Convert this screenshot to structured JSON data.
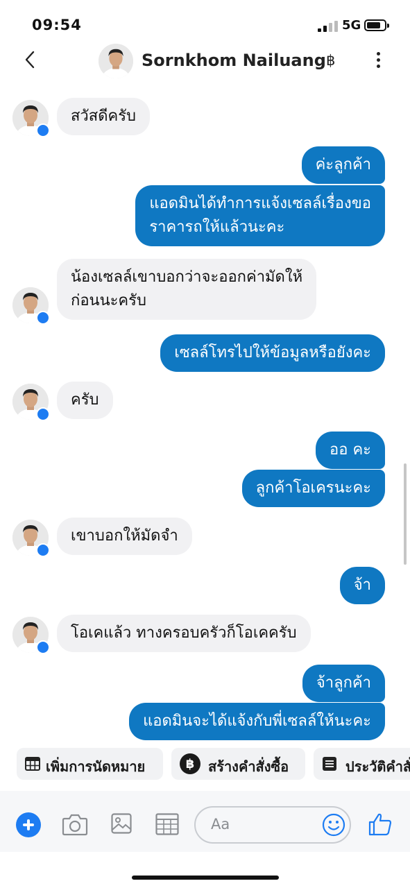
{
  "status_bar": {
    "time": "09:54",
    "network": "5G"
  },
  "header": {
    "contact_name": "Sornkhom Nailuang",
    "currency_symbol": "฿"
  },
  "messages": [
    {
      "side": "in",
      "text": "สวัสดีครับ"
    },
    {
      "side": "out",
      "text": "ค่ะลูกค้า"
    },
    {
      "side": "out",
      "text": "แอดมินได้ทำการแจ้งเซลล์เรื่องขอ\nราคารถให้แล้วนะคะ"
    },
    {
      "side": "in",
      "text": "น้องเซลล์เขาบอกว่าจะออกค่ามัดให้\nก่อนนะครับ"
    },
    {
      "side": "out",
      "text": "เซลล์โทรไปให้ข้อมูลหรือยังคะ"
    },
    {
      "side": "in",
      "text": "ครับ"
    },
    {
      "side": "out",
      "text": "ออ คะ"
    },
    {
      "side": "out",
      "text": "ลูกค้าโอเครนะคะ"
    },
    {
      "side": "in",
      "text": "เขาบอกให้มัดจำ"
    },
    {
      "side": "out",
      "text": "จ้า"
    },
    {
      "side": "in",
      "text": "โอเคแล้ว ทางครอบครัวก็โอเคครับ"
    },
    {
      "side": "out",
      "text": "จ้าลูกค้า"
    },
    {
      "side": "out",
      "text": "แอดมินจะได้แจ้งกับพี่เซลล์ให้นะคะ"
    }
  ],
  "quick_actions": [
    {
      "label": "เพิ่มการนัดหมาย",
      "icon": "calendar-icon"
    },
    {
      "label": "สร้างคำสั่งซื้อ",
      "icon": "baht-circle-icon"
    },
    {
      "label": "ประวัติคำสั่งซื้อ",
      "icon": "list-icon"
    }
  ],
  "composer": {
    "placeholder": "Aa"
  },
  "colors": {
    "outgoing_bubble": "#0f78c2",
    "incoming_bubble": "#f1f1f3",
    "accent": "#1d7cf2"
  }
}
